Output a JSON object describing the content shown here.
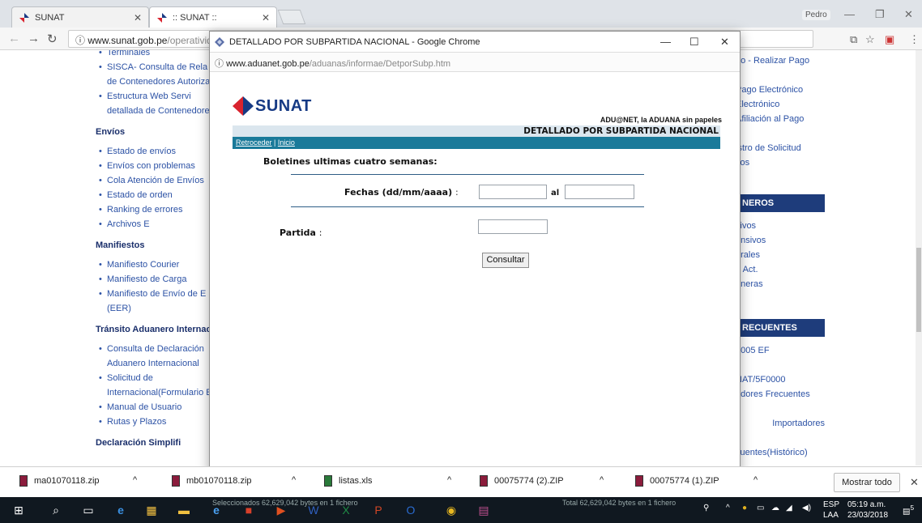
{
  "browser": {
    "tabs": [
      {
        "title": "SUNAT",
        "active": false
      },
      {
        "title": ":: SUNAT ::",
        "active": true
      }
    ],
    "profile": "Pedro",
    "url_host": "www.sunat.gob.pe",
    "url_path": "/operativid"
  },
  "background_page": {
    "left_menu": {
      "top_items": [
        "Terminales",
        "SISCA- Consulta de Rela",
        "de Contenedores Autoriza",
        "Estructura  Web  Servi",
        "detallada de Contenedore"
      ],
      "sections": [
        {
          "title": "Envíos",
          "items": [
            "Estado de envíos",
            "Envíos con problemas",
            "Cola Atención de Envíos",
            "Estado de orden",
            "Ranking de errores",
            "Archivos E"
          ]
        },
        {
          "title": "Manifiestos",
          "items": [
            "Manifiesto Courier",
            "Manifiesto de Carga",
            "Manifiesto de Envío de E",
            "(EER)"
          ]
        },
        {
          "title": "Tránsito Aduanero Internac",
          "items": [
            "Consulta  de  Declaración",
            "Aduanero Internacional",
            "Solicitud           de",
            "Internacional(Formulario E",
            "Manual de Usuario",
            "Rutas y Plazos"
          ]
        },
        {
          "title": "Declaración        Simplifi",
          "items": []
        }
      ]
    },
    "right_menu": {
      "lines_top": [
        "rio  -  Realizar Pago",
        "",
        "Pago Electrónico",
        "Electrónico",
        "Afiliación  al  Pago",
        "",
        "istro de Solicitud",
        "cos"
      ],
      "header1": "NEROS",
      "lines_mid": [
        "ltivos",
        "ensivos",
        "orales",
        "o Act.",
        "aneras"
      ],
      "header2": "RECUENTES",
      "lines_bottom": [
        "2005 EF",
        "",
        "NAT/5F0000",
        "adores  Frecuentes",
        "",
        "Importadores",
        "",
        "cuentes(Histórico)"
      ]
    }
  },
  "popup": {
    "title": "DETALLADO POR SUBPARTIDA NACIONAL - Google Chrome",
    "url_host": "www.aduanet.gob.pe",
    "url_path": "/aduanas/informae/DetporSubp.htm",
    "logo_text": "SUNAT",
    "tagline": "ADU@NET, la ADUANA  sin papeles",
    "page_title": "DETALLADO POR SUBPARTIDA NACIONAL",
    "nav_back": "Retroceder",
    "nav_sep": "|",
    "nav_home": "Inicio",
    "boletines": "Boletines ultimas cuatro semanas:",
    "fechas_label": "Fechas   (dd/mm/aaaa)",
    "colon": ":",
    "al_label": "al",
    "partida_label": "Partida",
    "fecha_desde": "",
    "fecha_hasta": "",
    "partida_value": "",
    "consultar": "Consultar"
  },
  "downloads": {
    "items": [
      {
        "name": "ma01070118.zip"
      },
      {
        "name": "mb01070118.zip"
      },
      {
        "name": "listas.xls"
      },
      {
        "name": "00075774 (2).ZIP"
      },
      {
        "name": "00075774 (1).ZIP"
      }
    ],
    "show_all": "Mostrar todo"
  },
  "taskbar": {
    "status_left": "Seleccionados 62,629,042 bytes en 1 fichero",
    "status_right": "Total 62,629,042 bytes en 1 fichero",
    "lang": "ESP",
    "lang2": "LAA",
    "time": "05:19 a.m.",
    "date": "23/03/2018",
    "notif": "5"
  },
  "colors": {
    "sunat_blue": "#163a84",
    "sunat_red": "#d9232e",
    "nav_teal": "#1a7a9a",
    "menu_header": "#1e3c7b"
  }
}
